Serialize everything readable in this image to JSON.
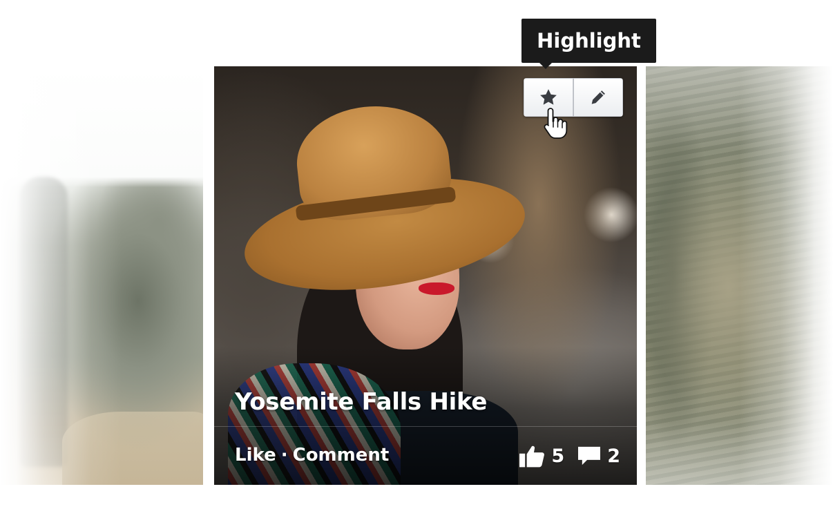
{
  "tooltip": {
    "text": "Highlight"
  },
  "card": {
    "title": "Yosemite Falls Hike",
    "actions": {
      "like_label": "Like",
      "separator": "·",
      "comment_label": "Comment"
    },
    "like_count": "5",
    "comment_count": "2",
    "toolbar": {
      "highlight_icon": "star-icon",
      "edit_icon": "pencil-icon"
    }
  },
  "colors": {
    "tooltip_bg": "#1b1b1b",
    "button_bg": "#f4f5f7",
    "text_on_photo": "#ffffff"
  }
}
